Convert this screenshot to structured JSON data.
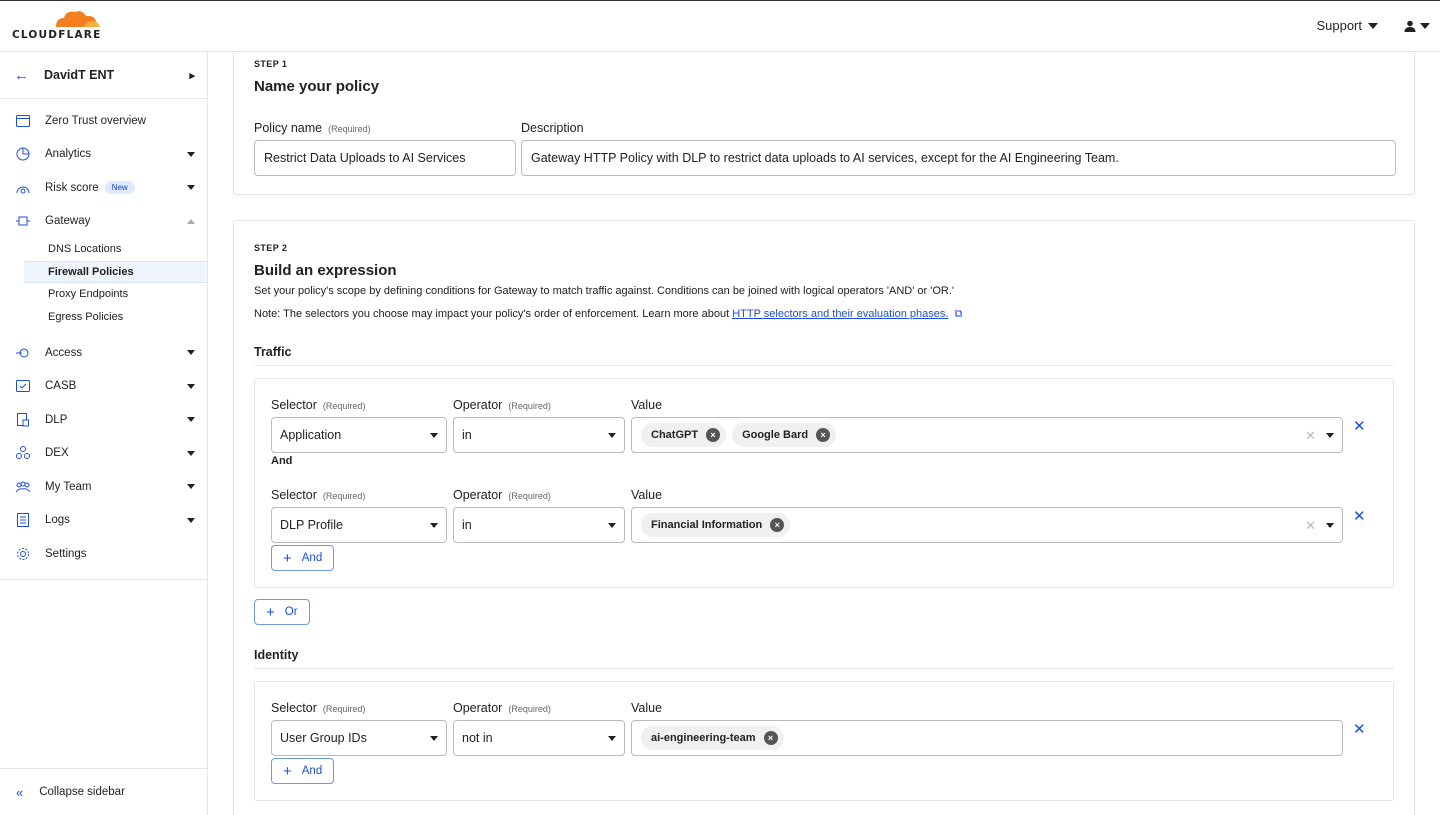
{
  "header": {
    "logo_text": "CLOUDFLARE",
    "support_label": "Support"
  },
  "sidebar": {
    "account_name": "DavidT ENT",
    "items": [
      {
        "label": "Zero Trust overview"
      },
      {
        "label": "Analytics"
      },
      {
        "label": "Risk score",
        "badge": "New"
      },
      {
        "label": "Gateway"
      },
      {
        "label": "Access"
      },
      {
        "label": "CASB"
      },
      {
        "label": "DLP"
      },
      {
        "label": "DEX"
      },
      {
        "label": "My Team"
      },
      {
        "label": "Logs"
      },
      {
        "label": "Settings"
      }
    ],
    "gateway_sub": [
      {
        "label": "DNS Locations"
      },
      {
        "label": "Firewall Policies"
      },
      {
        "label": "Proxy Endpoints"
      },
      {
        "label": "Egress Policies"
      }
    ],
    "collapse_label": "Collapse sidebar"
  },
  "step1": {
    "step_label": "STEP 1",
    "title": "Name your policy",
    "policy_name_label": "Policy name",
    "required": "(Required)",
    "policy_name_value": "Restrict Data Uploads to AI Services",
    "description_label": "Description",
    "description_value": "Gateway HTTP Policy with DLP to restrict data uploads to AI services, except for the AI Engineering Team."
  },
  "step2": {
    "step_label": "STEP 2",
    "title": "Build an expression",
    "desc": "Set your policy's scope by defining conditions for Gateway to match traffic against. Conditions can be joined with logical operators 'AND' or 'OR.'",
    "note_prefix": "Note: The selectors you choose may impact your policy's order of enforcement. Learn more about ",
    "note_link": "HTTP selectors and their evaluation phases.",
    "selector_label": "Selector",
    "operator_label": "Operator",
    "value_label": "Value",
    "required": "(Required)",
    "and_joiner": "And",
    "and_button": "And",
    "or_button": "Or",
    "traffic": {
      "title": "Traffic",
      "rows": [
        {
          "selector": "Application",
          "operator": "in",
          "values": [
            "ChatGPT",
            "Google Bard"
          ]
        },
        {
          "selector": "DLP Profile",
          "operator": "in",
          "values": [
            "Financial Information"
          ]
        }
      ]
    },
    "identity": {
      "title": "Identity",
      "rows": [
        {
          "selector": "User Group IDs",
          "operator": "not in",
          "values": [
            "ai-engineering-team"
          ]
        }
      ]
    }
  },
  "colors": {
    "accent": "#1d4ed8",
    "logo_orange": "#f38020",
    "active_bg": "#eef4fb"
  }
}
